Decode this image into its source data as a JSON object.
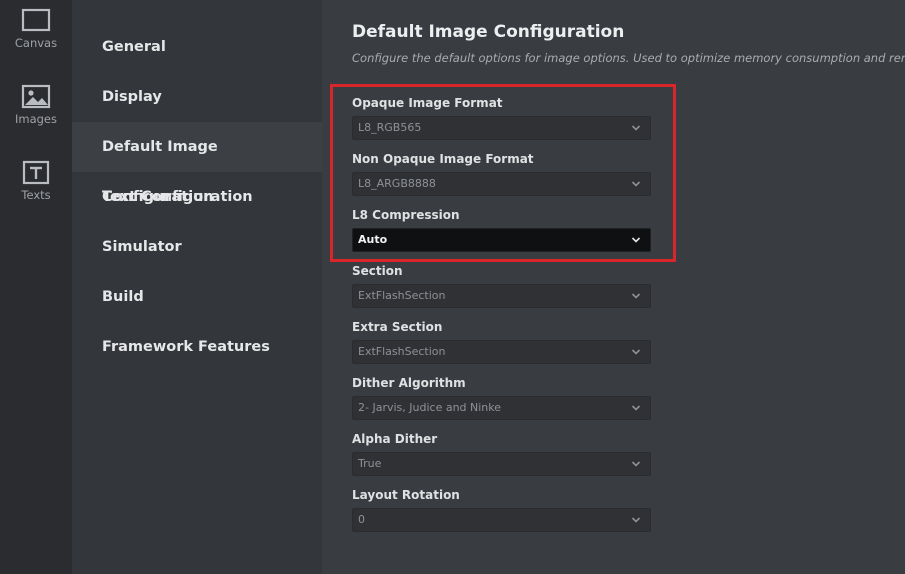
{
  "rail": {
    "items": [
      {
        "label": "Canvas",
        "icon": "canvas-icon"
      },
      {
        "label": "Images",
        "icon": "image-icon"
      },
      {
        "label": "Texts",
        "icon": "text-icon"
      }
    ]
  },
  "nav": {
    "items": [
      {
        "label": "General"
      },
      {
        "label": "Display"
      },
      {
        "label": "Default Image Configuration",
        "active": true
      },
      {
        "label": "Text Configuration"
      },
      {
        "label": "Simulator"
      },
      {
        "label": "Build"
      },
      {
        "label": "Framework Features"
      }
    ]
  },
  "main": {
    "title": "Default Image Configuration",
    "subtitle": "Configure the default options for image options. Used to optimize memory consumption and renderin",
    "fields": [
      {
        "label": "Opaque Image Format",
        "value": "L8_RGB565"
      },
      {
        "label": "Non Opaque Image Format",
        "value": "L8_ARGB8888"
      },
      {
        "label": "L8 Compression",
        "value": "Auto"
      },
      {
        "label": "Section",
        "value": "ExtFlashSection"
      },
      {
        "label": "Extra Section",
        "value": "ExtFlashSection"
      },
      {
        "label": "Dither Algorithm",
        "value": "2- Jarvis, Judice and Ninke"
      },
      {
        "label": "Alpha Dither",
        "value": "True"
      },
      {
        "label": "Layout Rotation",
        "value": "0"
      }
    ]
  },
  "colors": {
    "highlight": "#d9262b",
    "rail_bg": "#2a2c2f",
    "nav_bg": "#33363a",
    "content_bg": "#393c41"
  }
}
